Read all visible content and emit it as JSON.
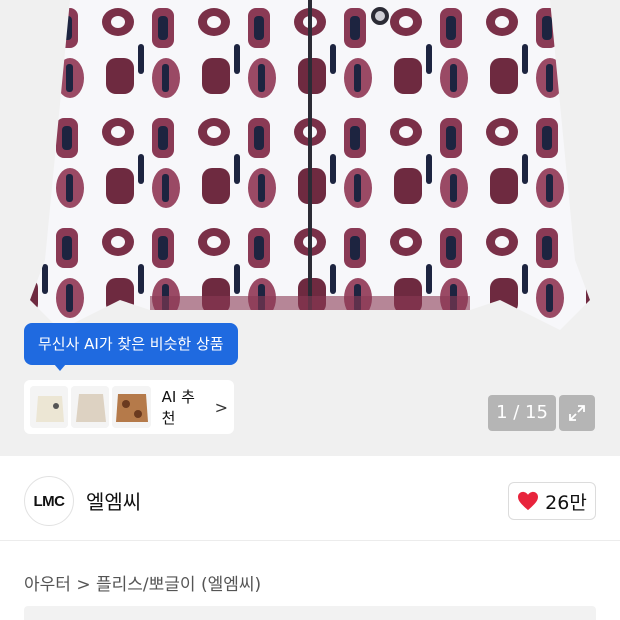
{
  "product_image": {
    "description_icon": "fleece-jacket-image",
    "counter": "1 / 15"
  },
  "ai_tooltip": {
    "label": "무신사 AI가 찾은 비슷한 상품"
  },
  "ai_recommend": {
    "label": "AI 추천",
    "chevron": ">"
  },
  "brand": {
    "logo_text": "LMC",
    "name": "엘엠씨"
  },
  "like": {
    "count": "26만",
    "color": "#e8243c"
  },
  "breadcrumb": {
    "text": "아우터 > 플리스/뽀글이 (엘엠씨)"
  },
  "colors": {
    "accent": "#1f6ae0",
    "pattern_maroon": "#7a3048",
    "pattern_navy": "#1d2440"
  }
}
